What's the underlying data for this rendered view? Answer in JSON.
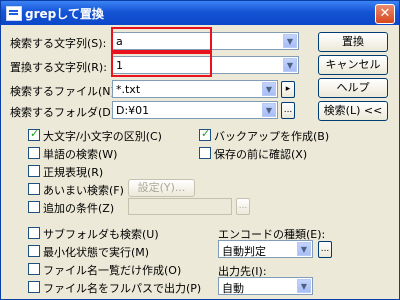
{
  "window": {
    "title": "grepして置換",
    "close": "✕"
  },
  "search": {
    "label": "検索する文字列(S):",
    "value": "a"
  },
  "replace": {
    "label": "置換する文字列(R):",
    "value": "1"
  },
  "file": {
    "label": "検索するファイル(N):",
    "value": "*.txt"
  },
  "folder": {
    "label": "検索するフォルダ(D):",
    "value": "D:¥01"
  },
  "buttons": {
    "replace": "置換",
    "cancel": "キャンセル",
    "help": "ヘルプ",
    "search_less": "検索(L) <<",
    "settings": "設定(Y)...",
    "small_arrow": "▸",
    "ellipsis": "...",
    "ellipsis2": "...",
    "ellipsis3": "..."
  },
  "options": {
    "case": "大文字/小文字の区別(C)",
    "word": "単語の検索(W)",
    "regex": "正規表現(R)",
    "fuzzy": "あいまい検索(F)",
    "extra": "追加の条件(Z)",
    "backup": "バックアップを作成(B)",
    "confirm": "保存の前に確認(X)",
    "subfolder": "サブフォルダも検索(U)",
    "minimized": "最小化状態で実行(M)",
    "filelist": "ファイル名一覧だけ作成(O)",
    "fullpath": "ファイル名をフルパスで出力(P)"
  },
  "checked": {
    "case": true,
    "backup": true
  },
  "encoding": {
    "label": "エンコードの種類(E):",
    "value": "自動判定"
  },
  "output": {
    "label": "出力先(I):",
    "value": "自動"
  }
}
